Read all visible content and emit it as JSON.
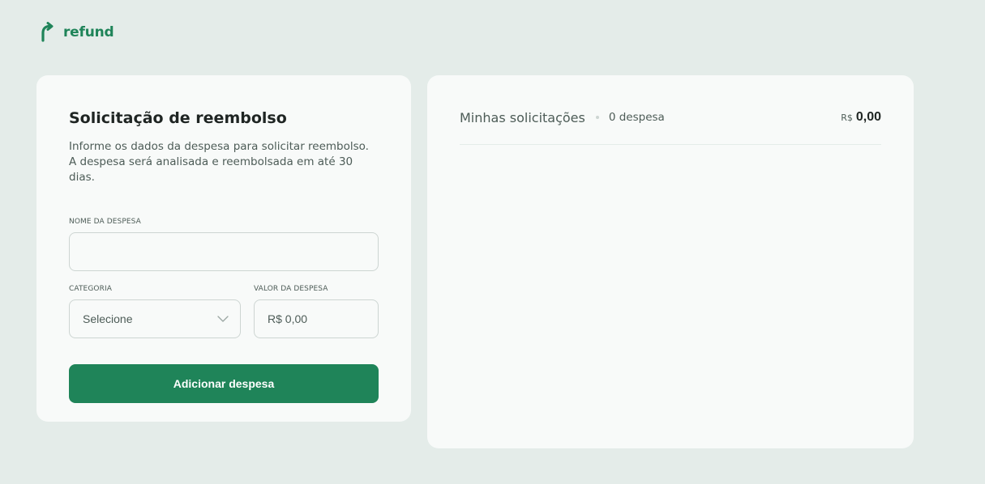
{
  "brand": {
    "name": "refund",
    "icon": "refresh-arrow-icon",
    "color": "#1F8459"
  },
  "form": {
    "title": "Solicitação de reembolso",
    "description": "Informe os dados da despesa para solicitar reembolso. A despesa será analisada e reembolsada em até 30 dias.",
    "expense_name": {
      "label": "NOME DA DESPESA",
      "value": ""
    },
    "category": {
      "label": "CATEGORIA",
      "selected": "Selecione",
      "icon": "chevron-down-icon"
    },
    "amount": {
      "label": "VALOR DA DESPESA",
      "placeholder": "R$ 0,00"
    },
    "submit_label": "Adicionar despesa"
  },
  "requests": {
    "title": "Minhas solicitações",
    "count_text": "0 despesa",
    "currency": "R$",
    "total": "0,00"
  }
}
